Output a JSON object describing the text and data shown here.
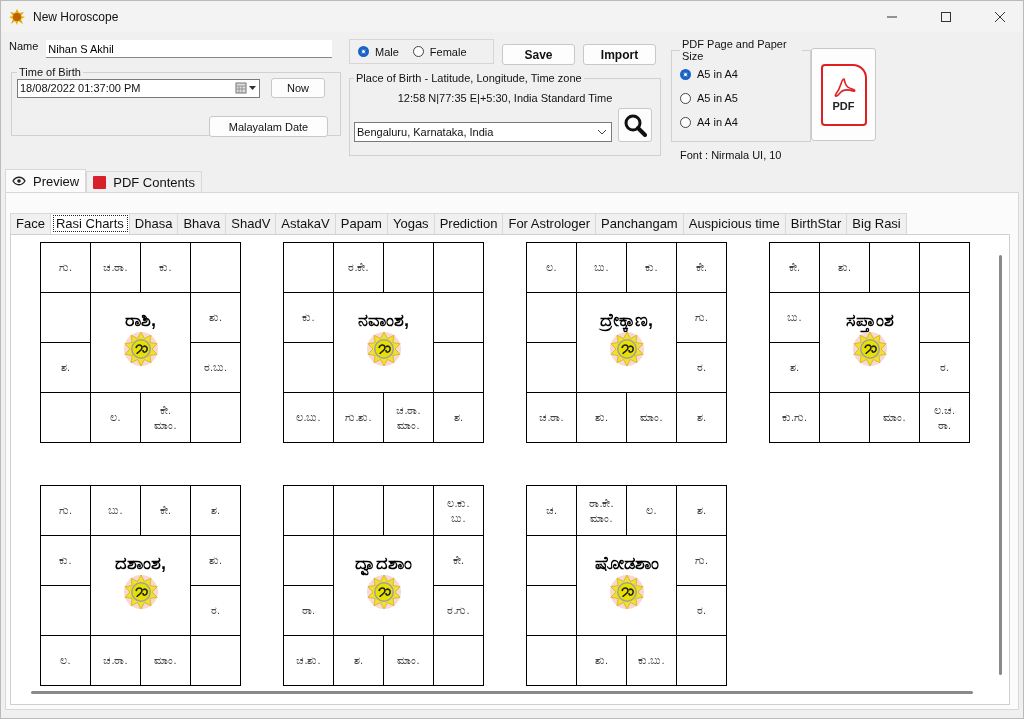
{
  "window": {
    "title": "New Horoscope"
  },
  "name_field": {
    "label": "Name",
    "value": "Nihan S Akhil"
  },
  "time_of_birth": {
    "legend": "Time of Birth",
    "value": "18/08/2022  01:37:00 PM",
    "now_button": "Now",
    "date_button": "Malayalam Date"
  },
  "gender": [
    {
      "label": "Male",
      "selected": true
    },
    {
      "label": "Female",
      "selected": false
    }
  ],
  "buttons": [
    "Save",
    "Import"
  ],
  "place_of_birth": {
    "legend": "Place of Birth - Latitude, Longitude, Time zone",
    "coordinates": "12:58 N|77:35 E|+5:30, India Standard Time",
    "value": "Bengaluru, Karnataka, India"
  },
  "pdf": {
    "legend": "PDF Page and Paper Size",
    "options": [
      {
        "label": "A5 in A4",
        "selected": true
      },
      {
        "label": "A5 in A5",
        "selected": false
      },
      {
        "label": "A4 in A4",
        "selected": false
      }
    ],
    "button": "PDF",
    "font": "Font : Nirmala UI, 10"
  },
  "outer_tabs": [
    {
      "label": "Preview",
      "selected": true
    },
    {
      "label": "PDF Contents",
      "selected": false
    }
  ],
  "tabs": [
    {
      "label": "Face",
      "selected": false
    },
    {
      "label": "Rasi Charts",
      "selected": true
    },
    {
      "label": "Dhasa",
      "selected": false
    },
    {
      "label": "Bhava",
      "selected": false
    },
    {
      "label": "ShadV",
      "selected": false
    },
    {
      "label": "AstakaV",
      "selected": false
    },
    {
      "label": "Papam",
      "selected": false
    },
    {
      "label": "Yogas",
      "selected": false
    },
    {
      "label": "Prediction",
      "selected": false
    },
    {
      "label": "For Astrologer",
      "selected": false
    },
    {
      "label": "Panchangam",
      "selected": false
    },
    {
      "label": "Auspicious time",
      "selected": false
    },
    {
      "label": "BirthStar",
      "selected": false
    },
    {
      "label": "Big Rasi",
      "selected": false
    }
  ],
  "charts": [
    {
      "title": "ರಾಶಿ,",
      "cells": [
        {
          "lines": [
            "ಗು."
          ]
        },
        {
          "lines": [
            "ಚ.ರಾ."
          ]
        },
        {
          "lines": [
            "ಕು."
          ]
        },
        {},
        {},
        {
          "lines": [
            "ಶು."
          ]
        },
        {
          "lines": [
            "ಶ."
          ]
        },
        {
          "lines": [
            "ರ.ಬು."
          ]
        },
        {},
        {
          "lines": [
            "ಲ."
          ]
        },
        {
          "lines": [
            "ಕೇ.",
            "ಮಾಂ."
          ]
        },
        {}
      ]
    },
    {
      "title": "ನವಾಂಶ,",
      "cells": [
        {},
        {
          "lines": [
            "ರ.ಕೇ."
          ]
        },
        {},
        {},
        {
          "lines": [
            "ಕು."
          ]
        },
        {},
        {},
        {},
        {
          "lines": [
            "ಲ.ಬು."
          ]
        },
        {
          "lines": [
            "ಗು.ಶು."
          ]
        },
        {
          "lines": [
            "ಚ.ರಾ.",
            "ಮಾಂ."
          ]
        },
        {
          "lines": [
            "ಶ."
          ]
        }
      ]
    },
    {
      "title": "ದ್ರೇಕ್ಕಾಣ,",
      "cells": [
        {
          "lines": [
            "ಲ."
          ]
        },
        {
          "lines": [
            "ಬು."
          ]
        },
        {
          "lines": [
            "ಕು."
          ]
        },
        {
          "lines": [
            "ಕೇ."
          ]
        },
        {},
        {
          "lines": [
            "ಗು."
          ]
        },
        {},
        {
          "lines": [
            "ರ."
          ]
        },
        {
          "lines": [
            "ಚ.ರಾ."
          ]
        },
        {
          "lines": [
            "ಶು."
          ]
        },
        {
          "lines": [
            "ಮಾಂ."
          ]
        },
        {
          "lines": [
            "ಶ."
          ]
        }
      ]
    },
    {
      "title": "ಸಪ್ತಾಂಶ",
      "cells": [
        {
          "lines": [
            "ಕೇ."
          ]
        },
        {
          "lines": [
            "ಶು."
          ]
        },
        {},
        {},
        {
          "lines": [
            "ಬು."
          ]
        },
        {},
        {
          "lines": [
            "ಶ."
          ]
        },
        {
          "lines": [
            "ರ."
          ]
        },
        {
          "lines": [
            "ಕು.ಗು."
          ]
        },
        {},
        {
          "lines": [
            "ಮಾಂ."
          ]
        },
        {
          "lines": [
            "ಲ.ಚ.",
            "ರಾ."
          ]
        }
      ]
    },
    {
      "title": "ದಶಾಂಶ,",
      "cells": [
        {
          "lines": [
            "ಗು."
          ]
        },
        {
          "lines": [
            "ಬು."
          ]
        },
        {
          "lines": [
            "ಕೇ."
          ]
        },
        {
          "lines": [
            "ಶ."
          ]
        },
        {
          "lines": [
            "ಕು."
          ]
        },
        {
          "lines": [
            "ಶು."
          ]
        },
        {},
        {
          "lines": [
            "ರ."
          ]
        },
        {
          "lines": [
            "ಲ."
          ]
        },
        {
          "lines": [
            "ಚ.ರಾ."
          ]
        },
        {
          "lines": [
            "ಮಾಂ."
          ]
        },
        {}
      ]
    },
    {
      "title": "ದ್ವಾದಶಾಂ",
      "cells": [
        {},
        {},
        {},
        {
          "lines": [
            "ಲ.ಕು.",
            "ಬು."
          ]
        },
        {},
        {
          "lines": [
            "ಕೇ."
          ]
        },
        {
          "lines": [
            "ರಾ."
          ]
        },
        {
          "lines": [
            "ರ.ಗು."
          ]
        },
        {
          "lines": [
            "ಚ.ಶು."
          ]
        },
        {
          "lines": [
            "ಶ."
          ]
        },
        {
          "lines": [
            "ಮಾಂ."
          ]
        },
        {}
      ]
    },
    {
      "title": "ಷೋಡಶಾಂ",
      "cells": [
        {
          "lines": [
            "ಚ."
          ]
        },
        {
          "lines": [
            "ರಾ.ಕೇ.",
            "ಮಾಂ."
          ]
        },
        {
          "lines": [
            "ಲ."
          ]
        },
        {
          "lines": [
            "ಶ."
          ]
        },
        {},
        {
          "lines": [
            "ಗು."
          ]
        },
        {},
        {
          "lines": [
            "ರ."
          ]
        },
        {},
        {
          "lines": [
            "ಶು."
          ]
        },
        {
          "lines": [
            "ಕು.ಬು."
          ]
        },
        {}
      ]
    }
  ]
}
